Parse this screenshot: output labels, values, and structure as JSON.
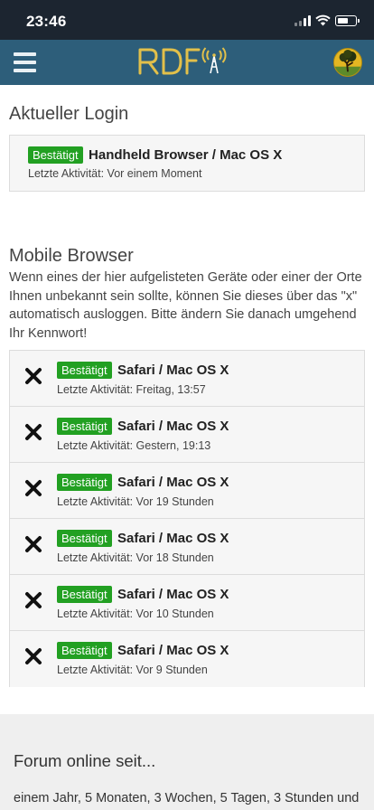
{
  "status_bar": {
    "time": "23:46"
  },
  "header": {
    "logo_text": "RDF",
    "menu_icon": "hamburger-icon",
    "avatar_icon": "tree-avatar",
    "colors": {
      "navbar": "#2d5e7a",
      "logo": "#e2c04a"
    }
  },
  "current_login": {
    "title": "Aktueller Login",
    "badge": "Bestätigt",
    "device": "Handheld Browser / Mac OS X",
    "activity": "Letzte Aktivität: Vor einem Moment"
  },
  "mobile_browser": {
    "title": "Mobile Browser",
    "description": "Wenn eines der hier aufgelisteten Geräte oder einer der Orte Ihnen unbekannt sein sollte, können Sie dieses über das \"x\" automatisch ausloggen. Bitte ändern Sie danach umgehend Ihr Kennwort!",
    "remove_icon": "close-icon",
    "devices": [
      {
        "badge": "Bestätigt",
        "device": "Safari / Mac OS X",
        "activity": "Letzte Aktivität: Freitag, 13:57"
      },
      {
        "badge": "Bestätigt",
        "device": "Safari / Mac OS X",
        "activity": "Letzte Aktivität: Gestern, 19:13"
      },
      {
        "badge": "Bestätigt",
        "device": "Safari / Mac OS X",
        "activity": "Letzte Aktivität: Vor 19 Stunden"
      },
      {
        "badge": "Bestätigt",
        "device": "Safari / Mac OS X",
        "activity": "Letzte Aktivität: Vor 18 Stunden"
      },
      {
        "badge": "Bestätigt",
        "device": "Safari / Mac OS X",
        "activity": "Letzte Aktivität: Vor 10 Stunden"
      },
      {
        "badge": "Bestätigt",
        "device": "Safari / Mac OS X",
        "activity": "Letzte Aktivität: Vor 9 Stunden"
      }
    ]
  },
  "footer": {
    "title": "Forum online seit...",
    "text": "einem Jahr, 5 Monaten, 3 Wochen, 5 Tagen, 3 Stunden und"
  }
}
